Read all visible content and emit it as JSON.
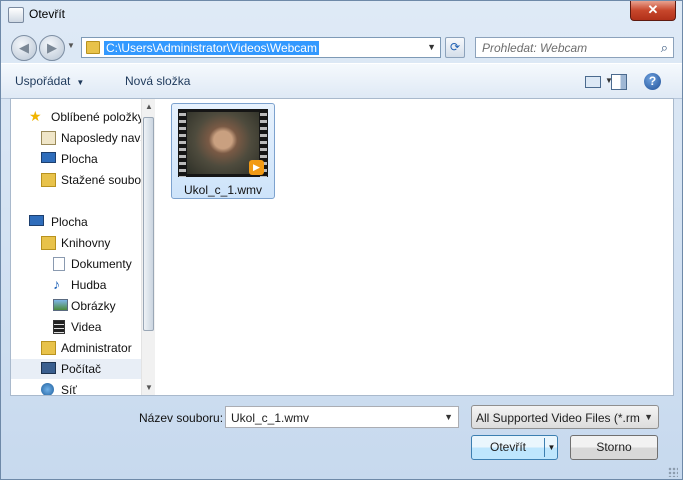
{
  "window": {
    "title": "Otevřít",
    "close_label": "✕"
  },
  "nav": {
    "address": "C:\\Users\\Administrator\\Videos\\Webcam",
    "search_placeholder": "Prohledat: Webcam"
  },
  "toolbar": {
    "organize": "Uspořádat",
    "new_folder": "Nová složka",
    "help": "?"
  },
  "sidebar": {
    "items": [
      {
        "label": "Oblíbené položky",
        "icon": "star-icon"
      },
      {
        "label": "Naposledy navštívené",
        "icon": "recent-places-icon"
      },
      {
        "label": "Plocha",
        "icon": "desktop-icon"
      },
      {
        "label": "Stažené soubory",
        "icon": "downloads-icon"
      },
      {
        "label": "Plocha",
        "icon": "desktop-icon"
      },
      {
        "label": "Knihovny",
        "icon": "libraries-icon"
      },
      {
        "label": "Dokumenty",
        "icon": "documents-icon"
      },
      {
        "label": "Hudba",
        "icon": "music-icon"
      },
      {
        "label": "Obrázky",
        "icon": "pictures-icon"
      },
      {
        "label": "Videa",
        "icon": "videos-icon"
      },
      {
        "label": "Administrator",
        "icon": "user-folder-icon"
      },
      {
        "label": "Počítač",
        "icon": "computer-icon"
      },
      {
        "label": "Síť",
        "icon": "network-icon"
      }
    ]
  },
  "files": [
    {
      "name": "Ukol_c_1.wmv",
      "icon": "video-thumbnail-icon"
    }
  ],
  "bottom": {
    "filename_label": "Název souboru:",
    "filename_value": "Ukol_c_1.wmv",
    "filter_value": "All Supported Video Files (*.rm;",
    "open_label": "Otevřít",
    "cancel_label": "Storno"
  }
}
